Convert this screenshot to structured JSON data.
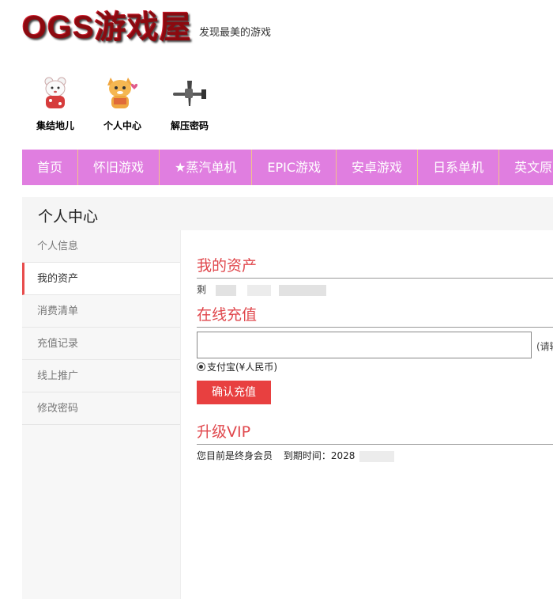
{
  "header": {
    "logo": "OGS游戏屋",
    "slogan": "发现最美的游戏"
  },
  "quick_links": [
    {
      "label": "集结地儿",
      "icon": "bear-mascot-icon"
    },
    {
      "label": "个人中心",
      "icon": "cat-mascot-icon"
    },
    {
      "label": "解压密码",
      "icon": "airplane-icon"
    }
  ],
  "nav": [
    "首页",
    "怀旧游戏",
    "★蒸汽单机",
    "EPIC游戏",
    "安卓游戏",
    "日系单机",
    "英文原"
  ],
  "page_title": "个人中心",
  "sidebar": [
    "个人信息",
    "我的资产",
    "消费清单",
    "充值记录",
    "线上推广",
    "修改密码"
  ],
  "sidebar_active": "我的资产",
  "assets": {
    "title": "我的资产",
    "prefix": "剩"
  },
  "recharge": {
    "title": "在线充值",
    "amount_value": "",
    "hint": "(请输",
    "payment_option": "支付宝(¥人民币)",
    "confirm_label": "确认充值"
  },
  "vip": {
    "title": "升级VIP",
    "status": "您目前是终身会员",
    "expiry_label": "到期时间：2028"
  },
  "colors": {
    "nav_bg": "#e07ee0",
    "accent": "#e0474c",
    "button": "#e84040"
  }
}
